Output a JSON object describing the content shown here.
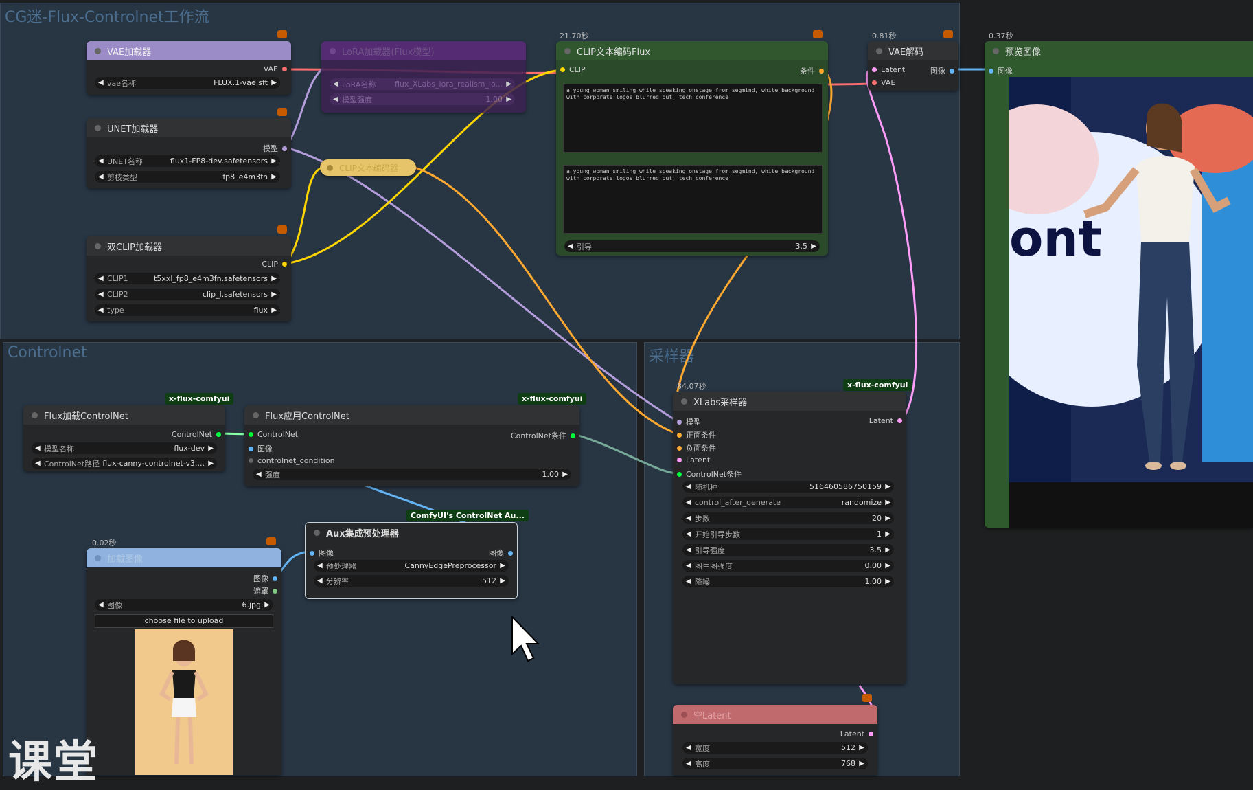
{
  "groups": {
    "workflow_title": "CG迷-Flux-Controlnet工作流",
    "controlnet_title": "Controlnet",
    "sampler_title": "采样器"
  },
  "timings": {
    "clip_encode": "21.70秒",
    "vae_decode": "0.81秒",
    "preview": "0.37秒",
    "sampler": "84.07秒",
    "load_image": "0.02秒"
  },
  "nodes": {
    "vae_loader": {
      "title": "VAE加载器",
      "out": "VAE",
      "widget_label": "vae名称",
      "widget_value": "FLUX.1-vae.sft"
    },
    "lora_loader": {
      "title": "LoRA加载器(Flux模型)",
      "widget1_label": "LoRA名称",
      "widget1_value": "flux_XLabs_lora_realism_lo...",
      "widget2_label": "模型强度",
      "widget2_value": "1.00"
    },
    "unet_loader": {
      "title": "UNET加载器",
      "out": "模型",
      "w1_label": "UNET名称",
      "w1_value": "flux1-FP8-dev.safetensors",
      "w2_label": "剪枝类型",
      "w2_value": "fp8_e4m3fn"
    },
    "dual_clip": {
      "title": "双CLIP加载器",
      "out": "CLIP",
      "w1_label": "CLIP1",
      "w1_value": "t5xxl_fp8_e4m3fn.safetensors",
      "w2_label": "CLIP2",
      "w2_value": "clip_l.safetensors",
      "w3_label": "type",
      "w3_value": "flux"
    },
    "clip_reroute": {
      "title": "CLIP文本编码器"
    },
    "clip_text_flux": {
      "title": "CLIP文本编码Flux",
      "in": "CLIP",
      "out": "条件",
      "prompt1": "a young woman smiling while speaking onstage from segmind, white background with corporate logos blurred out, tech conference",
      "prompt2": "a young woman smiling while speaking onstage from segmind, white background with corporate logos blurred out, tech conference",
      "guidance_label": "引导",
      "guidance_value": "3.5"
    },
    "vae_decode": {
      "title": "VAE解码",
      "in1": "Latent",
      "in2": "VAE",
      "out": "图像"
    },
    "preview": {
      "title": "预览图像",
      "in": "图像"
    },
    "flux_load_cn": {
      "tag": "x-flux-comfyui",
      "title": "Flux加载ControlNet",
      "out": "ControlNet",
      "w1_label": "模型名称",
      "w1_value": "flux-dev",
      "w2_label": "ControlNet路径",
      "w2_value": "flux-canny-controlnet-v3...."
    },
    "flux_apply_cn": {
      "tag": "x-flux-comfyui",
      "title": "Flux应用ControlNet",
      "in1": "ControlNet",
      "in2": "图像",
      "in3": "controlnet_condition",
      "out": "ControlNet条件",
      "w_label": "强度",
      "w_value": "1.00"
    },
    "aux": {
      "tag": "ComfyUI's ControlNet Au...",
      "title": "Aux集成预处理器",
      "in": "图像",
      "out": "图像",
      "w1_label": "预处理器",
      "w1_value": "CannyEdgePreprocessor",
      "w2_label": "分辨率",
      "w2_value": "512"
    },
    "load_image": {
      "title": "加载图像",
      "out1": "图像",
      "out2": "遮罩",
      "w_label": "图像",
      "w_value": "6.jpg",
      "upload": "choose file to upload"
    },
    "xlabs_sampler": {
      "tag": "x-flux-comfyui",
      "title": "XLabs采样器",
      "in1": "模型",
      "in2": "正面条件",
      "in3": "负面条件",
      "in4": "Latent",
      "in5": "ControlNet条件",
      "out": "Latent",
      "widgets": [
        {
          "label": "随机种",
          "value": "516460586750159"
        },
        {
          "label": "control_after_generate",
          "value": "randomize"
        },
        {
          "label": "步数",
          "value": "20"
        },
        {
          "label": "开始引导步数",
          "value": "1"
        },
        {
          "label": "引导强度",
          "value": "3.5"
        },
        {
          "label": "图生图强度",
          "value": "0.00"
        },
        {
          "label": "降噪",
          "value": "1.00"
        }
      ]
    },
    "empty_latent": {
      "title": "空Latent",
      "out": "Latent",
      "w1_label": "宽度",
      "w1_value": "512",
      "w2_label": "高度",
      "w2_value": "768"
    }
  },
  "watermark": "课堂",
  "colors": {
    "clip": "#ffd500",
    "vae": "#ff6e6e",
    "model": "#b39ddb",
    "conditioning": "#ffa931",
    "latent": "#ff9cf9",
    "image": "#64b5f6",
    "controlnet": "#00ff3c"
  }
}
